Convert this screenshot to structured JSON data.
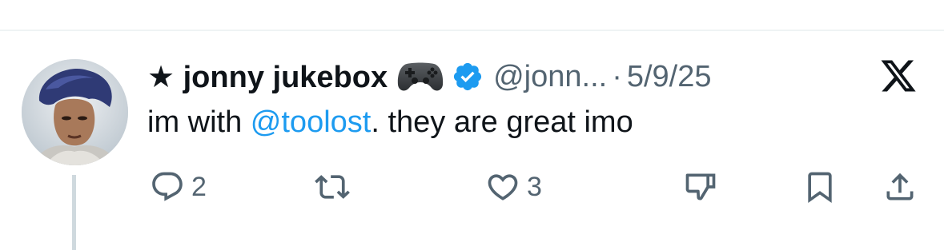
{
  "tweet": {
    "display_name": "★ jonny jukebox",
    "handle": "@jonn...",
    "separator": "·",
    "date": "5/9/25",
    "text_before_mention": "im with ",
    "mention": "@toolost",
    "text_after_mention": ". they are great imo",
    "emoji": "game-controller-emoji",
    "verified": true
  },
  "actions": {
    "reply_count": "2",
    "like_count": "3"
  },
  "colors": {
    "text": "#0f1419",
    "secondary": "#536471",
    "accent": "#1d9bf0",
    "rule": "#eff3f4"
  },
  "icons": [
    "reply-icon",
    "retweet-icon",
    "like-icon",
    "dislike-icon",
    "bookmark-icon",
    "share-icon",
    "x-logo-icon",
    "verified-badge-icon"
  ]
}
